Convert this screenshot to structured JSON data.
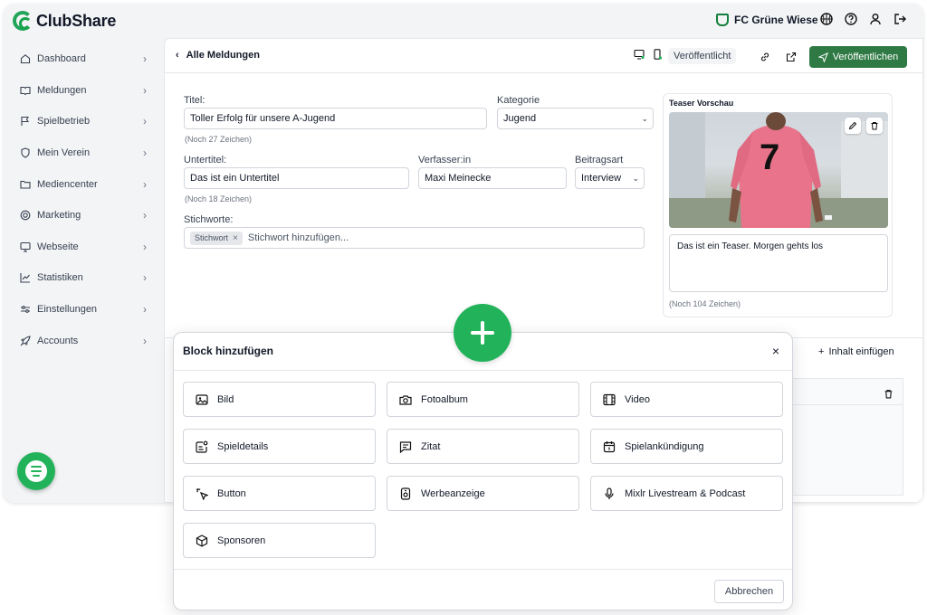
{
  "app": {
    "name": "ClubShare"
  },
  "header": {
    "club_name": "FC Grüne Wiese"
  },
  "sidebar": {
    "items": [
      {
        "label": "Dashboard",
        "icon": "home-icon"
      },
      {
        "label": "Meldungen",
        "icon": "book-icon"
      },
      {
        "label": "Spielbetrieb",
        "icon": "flag-icon"
      },
      {
        "label": "Mein Verein",
        "icon": "shield-icon"
      },
      {
        "label": "Mediencenter",
        "icon": "folder-icon"
      },
      {
        "label": "Marketing",
        "icon": "target-icon"
      },
      {
        "label": "Webseite",
        "icon": "monitor-icon"
      },
      {
        "label": "Statistiken",
        "icon": "chart-icon"
      },
      {
        "label": "Einstellungen",
        "icon": "sliders-icon"
      },
      {
        "label": "Accounts",
        "icon": "rocket-icon"
      }
    ]
  },
  "editor": {
    "back_label": "Alle Meldungen",
    "status": "Veröffentlicht",
    "publish_label": "Veröffentlichen",
    "title_label": "Titel:",
    "title_value": "Toller Erfolg für unsere A-Jugend",
    "title_hint": "(Noch 27 Zeichen)",
    "category_label": "Kategorie",
    "category_value": "Jugend",
    "subtitle_label": "Untertitel:",
    "subtitle_value": "Das ist ein Untertitel",
    "subtitle_hint": "(Noch 18 Zeichen)",
    "author_label": "Verfasser:in",
    "author_value": "Maxi Meinecke",
    "type_label": "Beitragsart",
    "type_value": "Interview",
    "tags_label": "Stichworte:",
    "tag": "Stichwort",
    "tag_placeholder": "Stichwort hinzufügen...",
    "insert_content": "Inhalt einfügen"
  },
  "teaser": {
    "title": "Teaser Vorschau",
    "text": "Das ist ein Teaser. Morgen gehts los",
    "hint": "(Noch 104 Zeichen)",
    "jersey_number": "7"
  },
  "modal": {
    "title": "Block hinzufügen",
    "cancel": "Abbrechen",
    "options": [
      {
        "label": "Bild",
        "icon": "image-icon"
      },
      {
        "label": "Fotoalbum",
        "icon": "camera-icon"
      },
      {
        "label": "Video",
        "icon": "film-icon"
      },
      {
        "label": "Spieldetails",
        "icon": "scoreboard-icon"
      },
      {
        "label": "Zitat",
        "icon": "quote-icon"
      },
      {
        "label": "Spielankündigung",
        "icon": "calendar-icon"
      },
      {
        "label": "Button",
        "icon": "pointer-icon"
      },
      {
        "label": "Werbeanzeige",
        "icon": "ad-icon"
      },
      {
        "label": "Mixlr Livestream & Podcast",
        "icon": "microphone-icon"
      },
      {
        "label": "Sponsoren",
        "icon": "box-icon"
      }
    ]
  },
  "colors": {
    "brand_green": "#22b35a",
    "publish_green": "#2f7a44"
  }
}
